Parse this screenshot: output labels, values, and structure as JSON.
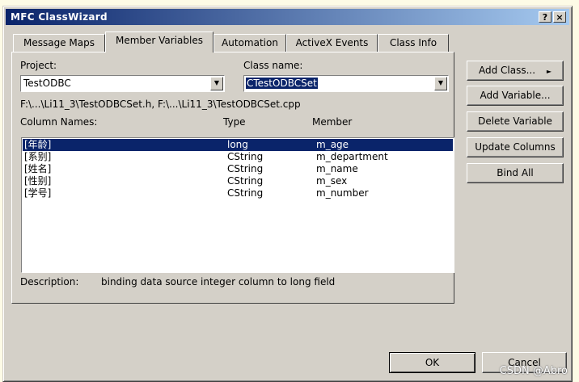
{
  "window": {
    "title": "MFC ClassWizard",
    "help_button": "?",
    "close_button": "×"
  },
  "tabs": [
    "Message Maps",
    "Member Variables",
    "Automation",
    "ActiveX Events",
    "Class Info"
  ],
  "active_tab": "Member Variables",
  "project": {
    "label": "Project:",
    "value": "TestODBC"
  },
  "class_name": {
    "label": "Class name:",
    "value": "CTestODBCSet"
  },
  "file_path": "F:\\...\\Li11_3\\TestODBCSet.h, F:\\...\\Li11_3\\TestODBCSet.cpp",
  "columns_header": {
    "name": "Column Names:",
    "type": "Type",
    "member": "Member"
  },
  "variables": [
    {
      "name": "[年龄]",
      "type": "long",
      "member": "m_age",
      "selected": true
    },
    {
      "name": "[系别]",
      "type": "CString",
      "member": "m_department",
      "selected": false
    },
    {
      "name": "[姓名]",
      "type": "CString",
      "member": "m_name",
      "selected": false
    },
    {
      "name": "[性别]",
      "type": "CString",
      "member": "m_sex",
      "selected": false
    },
    {
      "name": "[学号]",
      "type": "CString",
      "member": "m_number",
      "selected": false
    }
  ],
  "description": {
    "label": "Description:",
    "text": "binding data source integer column to long field"
  },
  "buttons": {
    "add_class": "Add Class...",
    "add_variable": "Add Variable...",
    "delete_variable": "Delete Variable",
    "update_columns": "Update Columns",
    "bind_all": "Bind All",
    "ok": "OK",
    "cancel": "Cancel"
  },
  "watermark": "CSDN @Abro",
  "colors": {
    "titlebar_start": "#0a246a",
    "titlebar_end": "#a6caf0",
    "selection": "#0a246a",
    "face": "#d4d0c8"
  }
}
